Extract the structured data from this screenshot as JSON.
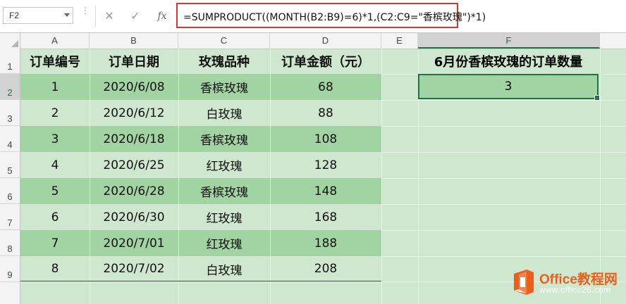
{
  "formula_bar": {
    "name_box": "F2",
    "cancel_icon": "✕",
    "enter_icon": "✓",
    "fx_label": "fx",
    "formula": "=SUMPRODUCT((MONTH(B2:B9)=6)*1,(C2:C9=\"香槟玫瑰\")*1)"
  },
  "columns": [
    "A",
    "B",
    "C",
    "D",
    "E",
    "F"
  ],
  "active_column": "F",
  "rows": [
    "1",
    "2",
    "3",
    "4",
    "5",
    "6",
    "7",
    "8",
    "9"
  ],
  "active_row": "2",
  "table": {
    "headers": [
      "订单编号",
      "订单日期",
      "玫瑰品种",
      "订单金额（元）"
    ],
    "rows": [
      [
        "1",
        "2020/6/08",
        "香槟玫瑰",
        "68"
      ],
      [
        "2",
        "2020/6/12",
        "白玫瑰",
        "88"
      ],
      [
        "3",
        "2020/6/18",
        "香槟玫瑰",
        "108"
      ],
      [
        "4",
        "2020/6/25",
        "红玫瑰",
        "128"
      ],
      [
        "5",
        "2020/6/28",
        "香槟玫瑰",
        "148"
      ],
      [
        "6",
        "2020/6/30",
        "红玫瑰",
        "168"
      ],
      [
        "7",
        "2020/7/01",
        "红玫瑰",
        "188"
      ],
      [
        "8",
        "2020/7/02",
        "白玫瑰",
        "208"
      ]
    ]
  },
  "result": {
    "title": "6月份香槟玫瑰的订单数量",
    "value": "3"
  },
  "watermark": {
    "brand": "Office",
    "brand_cn": "教程网",
    "url": "www.office26.com"
  },
  "colors": {
    "band_dark": "#a2d3a2",
    "band_light": "#cfe7ce",
    "excel_green": "#217346",
    "formula_highlight": "#e03030",
    "logo_orange": "#e8601c"
  }
}
